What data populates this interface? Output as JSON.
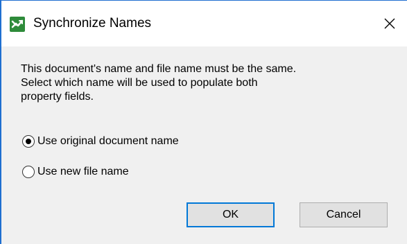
{
  "window": {
    "title": "Synchronize Names",
    "app_icon": "green-arrows-icon",
    "close_icon": "close-icon"
  },
  "message": {
    "lines": [
      "This document's name and file name must be the same.",
      "Select which name will be used to populate both",
      "property fields."
    ]
  },
  "options": [
    {
      "label": "Use original document name",
      "selected": true
    },
    {
      "label": "Use new file name",
      "selected": false
    }
  ],
  "buttons": {
    "ok_label": "OK",
    "cancel_label": "Cancel"
  },
  "colors": {
    "accent": "#0078d7",
    "icon_green": "#2e8b3a"
  }
}
